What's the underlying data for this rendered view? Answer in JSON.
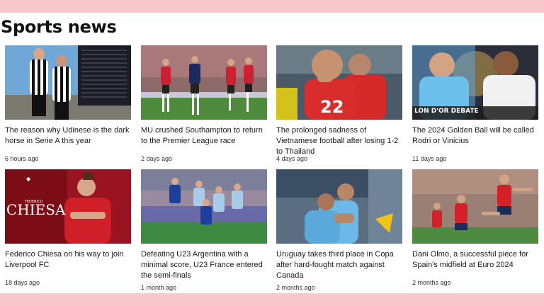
{
  "section": {
    "title": "Sports news"
  },
  "articles": [
    {
      "headline": "The reason why Udinese is the dark horse in Serie A this year",
      "time": "6 hours ago",
      "image": "udinese-players-and-standings-table"
    },
    {
      "headline": "MU crushed Southampton to return to the Premier League race",
      "time": "2 days ago",
      "image": "mu-vs-southampton-match"
    },
    {
      "headline": "The prolonged sadness of Vietnamese football after losing 1-2 to Thailand",
      "time": "4 days ago",
      "image": "vietnam-players-in-red"
    },
    {
      "headline": "The 2024 Golden Ball will be called Rodri or Vinicius",
      "time": "11 days ago",
      "image": "rodri-and-vinicius",
      "overlay_text": "LON D'OR DEBATE"
    },
    {
      "headline": "Federico Chiesa on his way to join Liverpool FC",
      "time": "18 days ago",
      "image": "chiesa-liverpool",
      "overlay_text": "CHIESA",
      "overlay_small": "FEDERICO"
    },
    {
      "headline": "Defeating U23 Argentina with a minimal score, U23 France entered the semi-finals",
      "time": "1 month ago",
      "image": "u23-argentina-vs-france"
    },
    {
      "headline": "Uruguay takes third place in Copa after hard-fought match against Canada",
      "time": "2 months ago",
      "image": "uruguay-players-celebrating"
    },
    {
      "headline": "Dani Olmo, a successful piece for Spain's midfield at Euro 2024",
      "time": "2 months ago",
      "image": "dani-olmo-spain"
    }
  ],
  "colors": {
    "page_border": "#f7c9cf",
    "background": "#ffffff",
    "text": "#1a1a1a"
  }
}
